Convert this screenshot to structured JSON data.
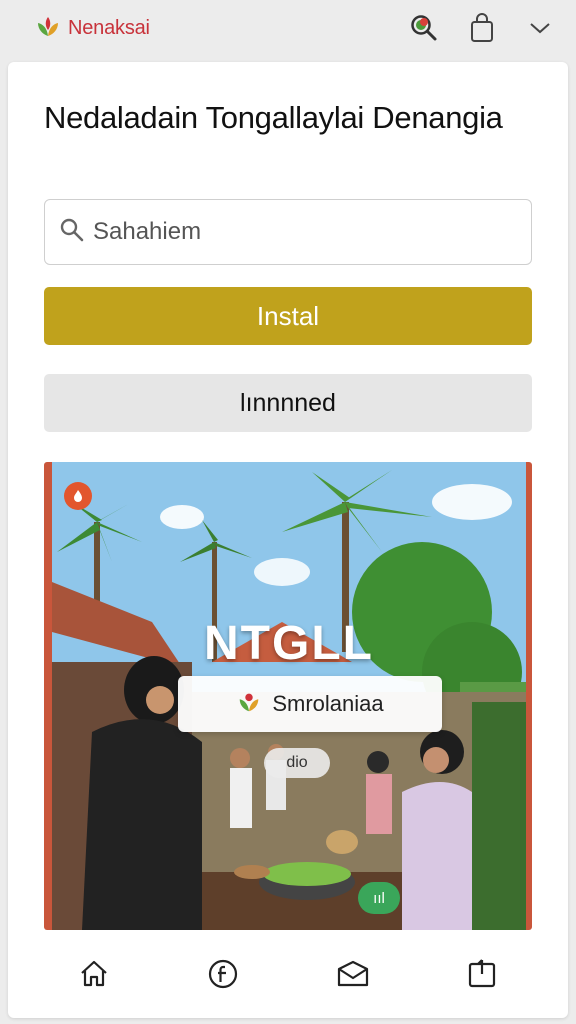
{
  "app": {
    "name": "Nenaksai",
    "brand_color": "#c8323a",
    "logo_icon": "leaf-flower-icon"
  },
  "header": {
    "actions": [
      {
        "icon": "search-app-icon"
      },
      {
        "icon": "shopping-bag-icon"
      },
      {
        "icon": "chevron-down-icon"
      }
    ]
  },
  "main": {
    "title": "Nedaladain Tongallaylai Denangia",
    "search": {
      "placeholder": "Sahahiem",
      "value": ""
    },
    "install_label": "Instal",
    "secondary_label": "lınnnned",
    "accent": "#c0a21c"
  },
  "hero": {
    "heading": "NTGLL",
    "chip_label": "Smrolaniaa",
    "pill_label": "dio",
    "green_badge": "ııl"
  },
  "bottom_nav": [
    {
      "icon": "home-icon"
    },
    {
      "icon": "facebook-icon"
    },
    {
      "icon": "mail-icon"
    },
    {
      "icon": "share-icon"
    }
  ]
}
